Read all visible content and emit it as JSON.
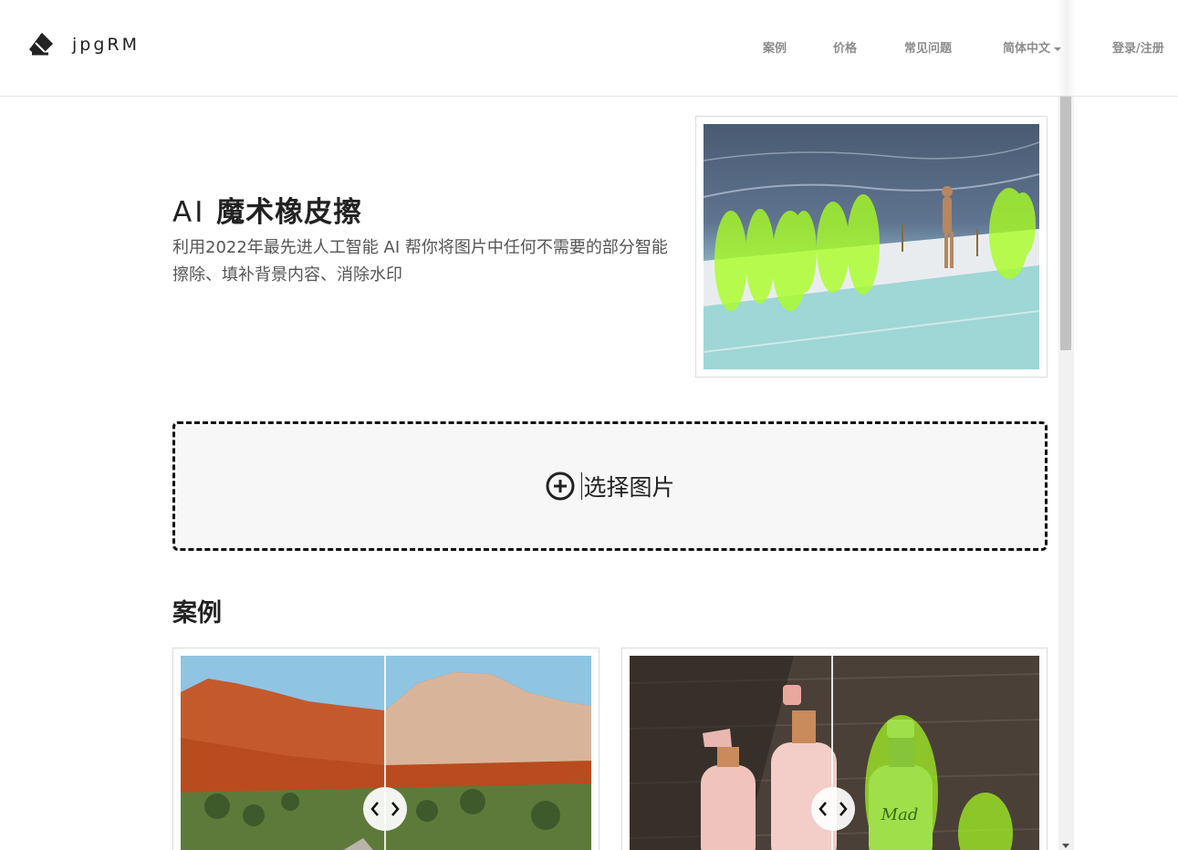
{
  "brand": {
    "name": "jpgRM"
  },
  "nav": {
    "cases": "案例",
    "pricing": "价格",
    "faq": "常见问题",
    "language": "简体中文",
    "login": "登录/注册"
  },
  "hero": {
    "title_ai": "AI",
    "title_rest": " 魔术橡皮擦",
    "subtitle": "利用2022年最先进人工智能 AI 帮你将图片中任何不需要的部分智能擦除、填补背景内容、消除水印"
  },
  "upload": {
    "label": "选择图片"
  },
  "cases": {
    "title": "案例"
  },
  "colors": {
    "accent_highlight": "#aaff22",
    "text": "#222222",
    "nav": "#8c8c8c"
  },
  "icons": [
    "eraser-icon",
    "caret-down-icon",
    "plus-circle-icon",
    "compare-arrows-icon"
  ]
}
